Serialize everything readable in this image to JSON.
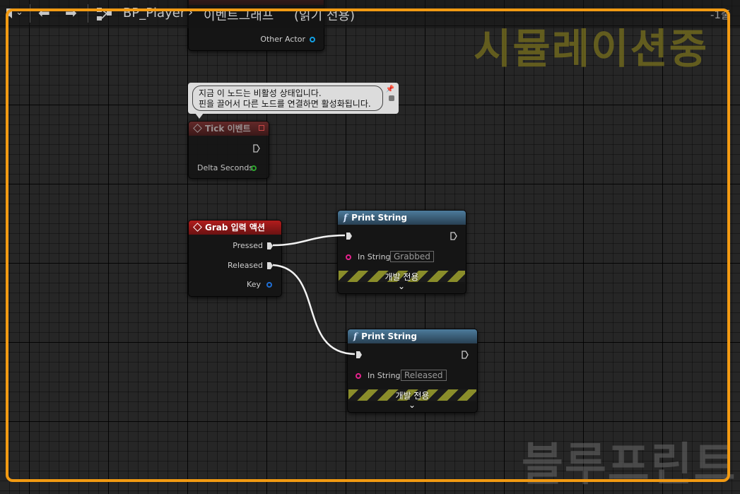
{
  "header": {
    "blueprint_name": "BP_Player",
    "graph_path": "이벤트그래프",
    "read_only_label": "(읽기 전용)",
    "zoom_label": "-1",
    "zoom_suffix": "줄"
  },
  "watermarks": {
    "simulating": "시뮬레이션중",
    "blueprint": "블루프린트"
  },
  "nodes": {
    "overlap_partial": {
      "pin_other_actor": "Other Actor"
    },
    "comment": {
      "line1": "지금 이 노드는 비활성 상태입니다.",
      "line2": "핀을 끌어서 다른 노드를 연결하면 활성화됩니다."
    },
    "tick": {
      "title": "Tick 이벤트",
      "pin_delta": "Delta Seconds"
    },
    "grab": {
      "title": "Grab 입력 액션",
      "pin_pressed": "Pressed",
      "pin_released": "Released",
      "pin_key": "Key"
    },
    "print1": {
      "title": "Print String",
      "pin_in_string": "In String",
      "value": "Grabbed",
      "dev_only": "개발 전용"
    },
    "print2": {
      "title": "Print String",
      "pin_in_string": "In String",
      "value": "Released",
      "dev_only": "개발 전용"
    }
  },
  "icons": {
    "bookmark": "bookmark-icon",
    "back": "arrow-left-icon",
    "forward": "arrow-right-icon",
    "graph": "graph-icon",
    "function": "function-f-icon",
    "event": "event-diamond-icon"
  },
  "colors": {
    "simulation_border": "#f29a12",
    "exec_wire": "#ffffff",
    "struct_pin": "#1f6fd6",
    "string_pin": "#e4228c",
    "float_pin": "#2fae2f",
    "object_pin": "#12a1e6"
  }
}
